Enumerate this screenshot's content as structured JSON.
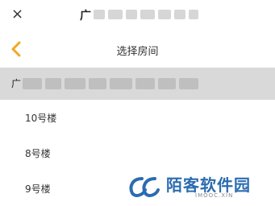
{
  "topbar": {
    "close_glyph": "×",
    "title_visible_char": "广",
    "close_icon": "close-icon"
  },
  "navbar": {
    "title": "选择房间",
    "back_icon": "chevron-left-icon",
    "accent_color": "#f5a623"
  },
  "selected": {
    "label_visible_char": "广"
  },
  "buildings": [
    {
      "label": "10号楼"
    },
    {
      "label": "8号楼"
    },
    {
      "label": "9号楼"
    }
  ],
  "watermark": {
    "name": "陌客软件园",
    "sub": "IMOOC.XIN"
  }
}
